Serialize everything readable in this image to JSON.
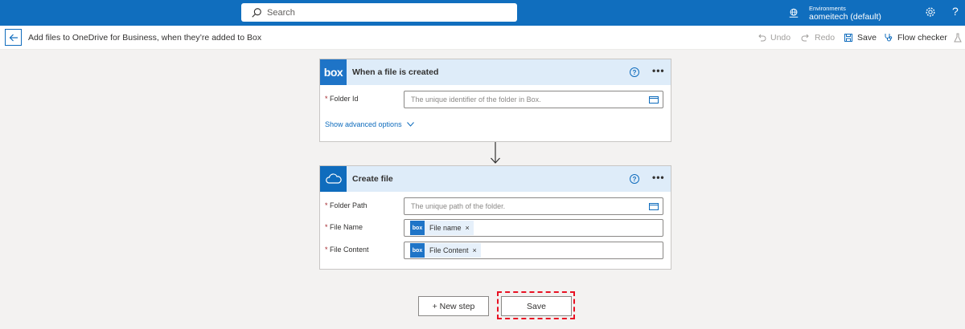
{
  "topbar": {
    "search_placeholder": "Search",
    "environments_label": "Environments",
    "environment_name": "aomeitech (default)",
    "help_glyph": "?"
  },
  "cmdbar": {
    "flow_title": "Add files to OneDrive for Business, when they’re added to Box",
    "undo_label": "Undo",
    "redo_label": "Redo",
    "save_label": "Save",
    "flow_checker_label": "Flow checker"
  },
  "trigger": {
    "logo_text": "box",
    "title": "When a file is created",
    "help_glyph": "?",
    "more_glyph": "•••",
    "fields": [
      {
        "label": "Folder Id",
        "placeholder": "The unique identifier of the folder in Box."
      }
    ],
    "advanced_label": "Show advanced options"
  },
  "action": {
    "title": "Create file",
    "help_glyph": "?",
    "more_glyph": "•••",
    "fields": [
      {
        "label": "Folder Path",
        "placeholder": "The unique path of the folder."
      },
      {
        "label": "File Name",
        "token_label": "File name",
        "token_logo": "box"
      },
      {
        "label": "File Content",
        "token_label": "File Content",
        "token_logo": "box"
      }
    ],
    "required_mark": "*",
    "token_remove_glyph": "×"
  },
  "footer": {
    "new_step_label": "+ New step",
    "save_label": "Save"
  },
  "colors": {
    "topbar": "#106ebe",
    "card_header": "#deecf9",
    "accent": "#0f6cbd",
    "highlight": "#e81123"
  }
}
